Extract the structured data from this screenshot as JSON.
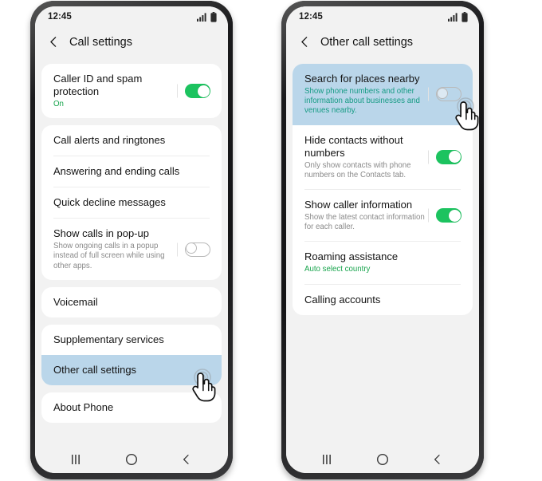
{
  "phones": [
    {
      "id": "call-settings",
      "status": {
        "time": "12:45",
        "signal_icon": "signal-bars-icon",
        "battery_icon": "battery-icon"
      },
      "header": {
        "back_icon": "back-chevron-icon",
        "title": "Call settings"
      },
      "cards": [
        {
          "rows": [
            {
              "title": "Caller ID and spam protection",
              "sub": "On",
              "sub_style": "green",
              "toggle": "on",
              "highlight": false
            }
          ]
        },
        {
          "rows": [
            {
              "title": "Call alerts and ringtones",
              "sub": "",
              "toggle": "none",
              "highlight": false
            },
            {
              "title": "Answering and ending calls",
              "sub": "",
              "toggle": "none",
              "highlight": false
            },
            {
              "title": "Quick decline messages",
              "sub": "",
              "toggle": "none",
              "highlight": false
            },
            {
              "title": "Show calls in pop-up",
              "sub": "Show ongoing calls in a popup instead of full screen while using other apps.",
              "sub_style": "gray",
              "toggle": "off",
              "highlight": false
            }
          ]
        },
        {
          "rows": [
            {
              "title": "Voicemail",
              "sub": "",
              "toggle": "none",
              "highlight": false
            }
          ]
        },
        {
          "rows": [
            {
              "title": "Supplementary services",
              "sub": "",
              "toggle": "none",
              "highlight": false
            },
            {
              "title": "Other call settings",
              "sub": "",
              "toggle": "none",
              "highlight": true
            }
          ]
        },
        {
          "rows": [
            {
              "title": "About Phone",
              "sub": "",
              "toggle": "none",
              "highlight": false
            }
          ]
        }
      ],
      "nav": {
        "recents_icon": "recents-icon",
        "home_icon": "home-icon",
        "back_icon": "back-icon"
      },
      "cursor": {
        "icon": "hand-pointer-tap-icon",
        "target": "Other call settings"
      }
    },
    {
      "id": "other-call-settings",
      "status": {
        "time": "12:45",
        "signal_icon": "signal-bars-icon",
        "battery_icon": "battery-icon"
      },
      "header": {
        "back_icon": "back-chevron-icon",
        "title": "Other call settings"
      },
      "cards": [
        {
          "rows": [
            {
              "title": "Search for places nearby",
              "sub": "Show phone numbers and other information about businesses and venues nearby.",
              "sub_style": "teal",
              "toggle": "off",
              "highlight": true
            },
            {
              "title": "Hide contacts without numbers",
              "sub": "Only show contacts with phone numbers on the Contacts tab.",
              "sub_style": "gray",
              "toggle": "on",
              "highlight": false
            },
            {
              "title": "Show caller information",
              "sub": "Show the latest contact information for each caller.",
              "sub_style": "gray",
              "toggle": "on",
              "highlight": false
            },
            {
              "title": "Roaming assistance",
              "sub": "Auto select country",
              "sub_style": "green",
              "toggle": "none",
              "highlight": false
            },
            {
              "title": "Calling accounts",
              "sub": "",
              "toggle": "none",
              "highlight": false
            }
          ]
        }
      ],
      "nav": {
        "recents_icon": "recents-icon",
        "home_icon": "home-icon",
        "back_icon": "back-icon"
      },
      "cursor": {
        "icon": "hand-pointer-tap-icon",
        "target": "Search for places nearby toggle"
      }
    }
  ],
  "colors": {
    "toggle_on": "#1cc35f",
    "highlight": "#bad6ea",
    "screen_bg": "#f2f2f2",
    "card_bg": "#ffffff",
    "sub_green": "#17a44c",
    "sub_teal": "#169b84",
    "sub_gray": "#8a8a8a",
    "frame": "#1d1d1f"
  }
}
